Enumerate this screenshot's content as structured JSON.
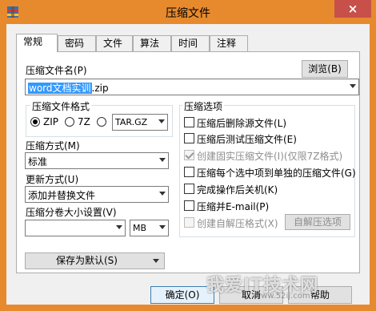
{
  "window": {
    "title": "压缩文件",
    "close_label": "×",
    "accent_color": "#e78a2e"
  },
  "tabs": [
    "常规",
    "密码",
    "文件",
    "算法",
    "时间",
    "注释"
  ],
  "general": {
    "archive_name_label": "压缩文件名(P)",
    "browse_label": "浏览(B)",
    "archive_name_selected": "word文档实训",
    "archive_name_rest": ".zip",
    "format_group_title": "压缩文件格式",
    "format_zip_label": "ZIP",
    "format_7z_label": "7Z",
    "format_tar_value": "TAR.GZ",
    "method_label": "压缩方式(M)",
    "method_value": "标准",
    "update_label": "更新方式(U)",
    "update_value": "添加并替换文件",
    "split_label": "压缩分卷大小设置(V)",
    "split_value": "",
    "split_unit": "MB",
    "save_default_label": "保存为默认(S)",
    "options_group_title": "压缩选项",
    "options": [
      {
        "label": "压缩后删除源文件(L)",
        "checked": false,
        "disabled": false
      },
      {
        "label": "压缩后测试压缩文件(E)",
        "checked": false,
        "disabled": false
      },
      {
        "label": "创建固实压缩文件(I)(仅限7Z格式)",
        "checked": true,
        "disabled": true
      },
      {
        "label": "压缩每个选中项到单独的压缩文件(G)",
        "checked": false,
        "disabled": false
      },
      {
        "label": "完成操作后关机(K)",
        "checked": false,
        "disabled": false
      },
      {
        "label": "压缩并E-mail(P)",
        "checked": false,
        "disabled": false
      },
      {
        "label": "创建自解压格式(X)",
        "checked": false,
        "disabled": true
      }
    ],
    "sfx_options_label": "自解压选项"
  },
  "footer": {
    "ok_label": "确定(O)",
    "cancel_label": "取消",
    "help_label": "帮助"
  },
  "watermark": {
    "text": "我爱IT技术网",
    "url": "www.52ij.com"
  }
}
